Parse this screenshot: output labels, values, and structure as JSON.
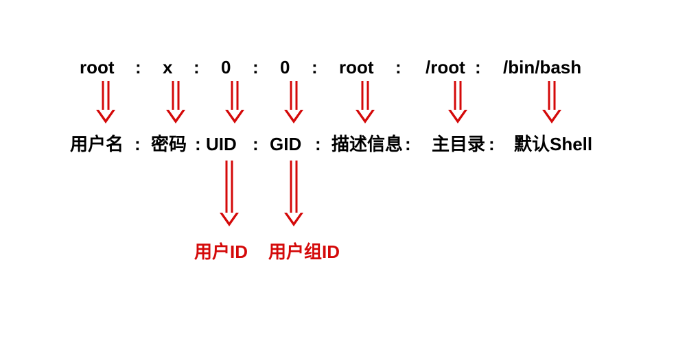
{
  "colors": {
    "arrow": "#d40909",
    "text": "#000000",
    "accent_text": "#d40909"
  },
  "row1": {
    "fields": [
      "root",
      "x",
      "0",
      "0",
      "root",
      "/root",
      "/bin/bash"
    ],
    "sep": ":"
  },
  "row2": {
    "labels": [
      "用户名",
      "密码",
      "UID",
      "GID",
      "描述信息",
      "主目录",
      "默认Shell"
    ],
    "sep": ":"
  },
  "row3": {
    "labels": [
      "用户ID",
      "用户组ID"
    ]
  }
}
